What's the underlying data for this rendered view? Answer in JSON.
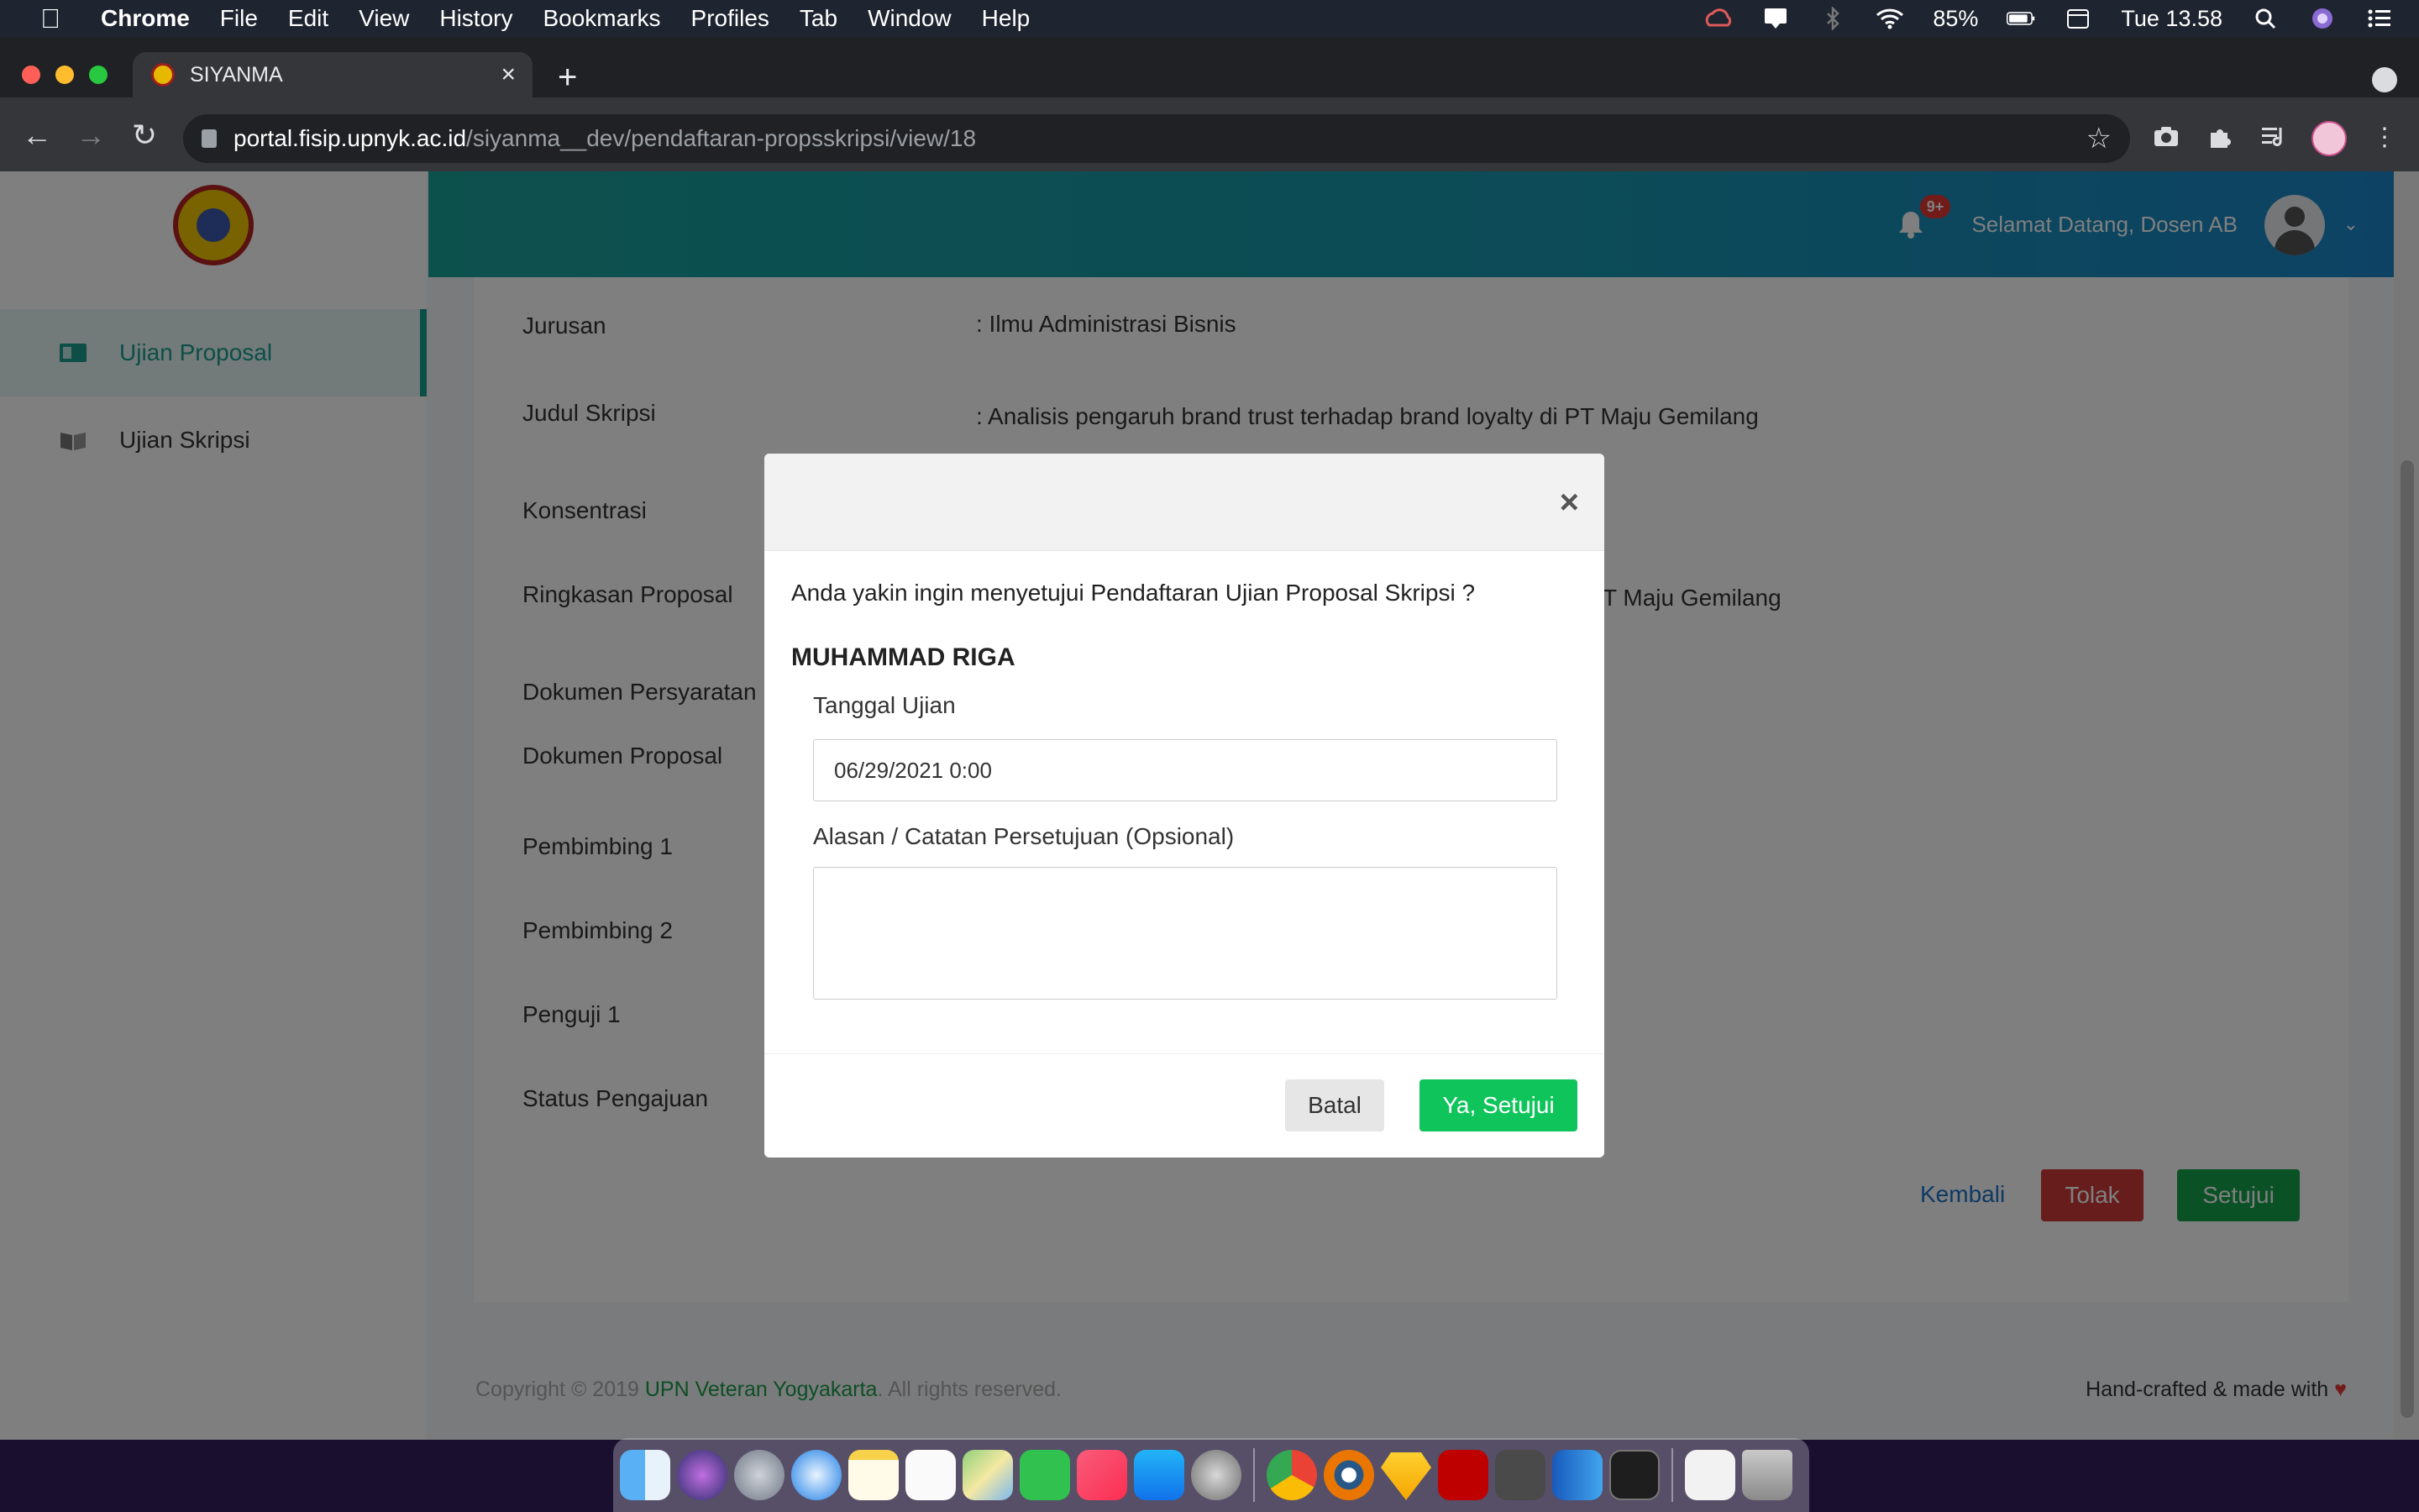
{
  "menubar": {
    "app": "Chrome",
    "items": [
      "File",
      "Edit",
      "View",
      "History",
      "Bookmarks",
      "Profiles",
      "Tab",
      "Window",
      "Help"
    ],
    "battery": "85%",
    "clock": "Tue 13.58"
  },
  "browser": {
    "tab_title": "SIYANMA",
    "url_host": "portal.fisip.upnyk.ac.id",
    "url_path": "/siyanma__dev/pendaftaran-propsskripsi/view/18"
  },
  "sidebar": {
    "items": [
      {
        "label": "Ujian Proposal",
        "active": true
      },
      {
        "label": "Ujian Skripsi",
        "active": false
      }
    ]
  },
  "header": {
    "notification_badge": "9+",
    "welcome": "Selamat Datang, Dosen AB"
  },
  "detail": {
    "rows": [
      {
        "label": "Jurusan",
        "value": ": Ilmu Administrasi Bisnis"
      },
      {
        "label": "Judul Skripsi",
        "value": ": Analisis pengaruh brand trust terhadap brand loyalty di PT Maju Gemilang"
      },
      {
        "label": "Konsentrasi",
        "value": ""
      },
      {
        "label": "Ringkasan Proposal",
        "value": "T Maju Gemilang"
      },
      {
        "label": "Dokumen Persyaratan",
        "value": ""
      },
      {
        "label": "Dokumen Proposal",
        "value": ""
      },
      {
        "label": "Pembimbing 1",
        "value": ""
      },
      {
        "label": "Pembimbing 2",
        "value": ""
      },
      {
        "label": "Penguji 1",
        "value": ""
      },
      {
        "label": "Status Pengajuan",
        "value": ""
      }
    ],
    "buttons": {
      "back": "Kembali",
      "reject": "Tolak",
      "approve": "Setujui"
    }
  },
  "footer": {
    "copyright_prefix": "Copyright © 2019",
    "brand": "UPN Veteran Yogyakarta",
    "copyright_suffix": ". All rights reserved.",
    "right": "Hand-crafted & made with"
  },
  "modal": {
    "close": "×",
    "question": "Anda yakin ingin menyetujui Pendaftaran Ujian Proposal Skripsi ?",
    "student_name": "MUHAMMAD RIGA",
    "date_label": "Tanggal Ujian",
    "date_value": "06/29/2021 0:00",
    "notes_label": "Alasan / Catatan Persetujuan (Opsional)",
    "notes_value": "",
    "cancel": "Batal",
    "confirm": "Ya, Setujui"
  },
  "colors": {
    "accent_teal": "#1a9c8e",
    "approve_green": "#0fc45a",
    "reject_red": "#d13b3b",
    "header_gradient_start": "#1aa29a",
    "header_gradient_end": "#1a85c9"
  },
  "dock_apps": [
    "finder-icon",
    "siri-icon",
    "launchpad-icon",
    "safari-icon",
    "notes-icon",
    "reminders-icon",
    "maps-icon",
    "facetime-icon",
    "music-icon",
    "app-store-icon",
    "system-preferences-icon",
    "chrome-icon",
    "blender-icon",
    "sketch-icon",
    "filezilla-icon",
    "sublime-icon",
    "word-icon",
    "terminal-icon",
    "document-icon",
    "trash-icon"
  ]
}
